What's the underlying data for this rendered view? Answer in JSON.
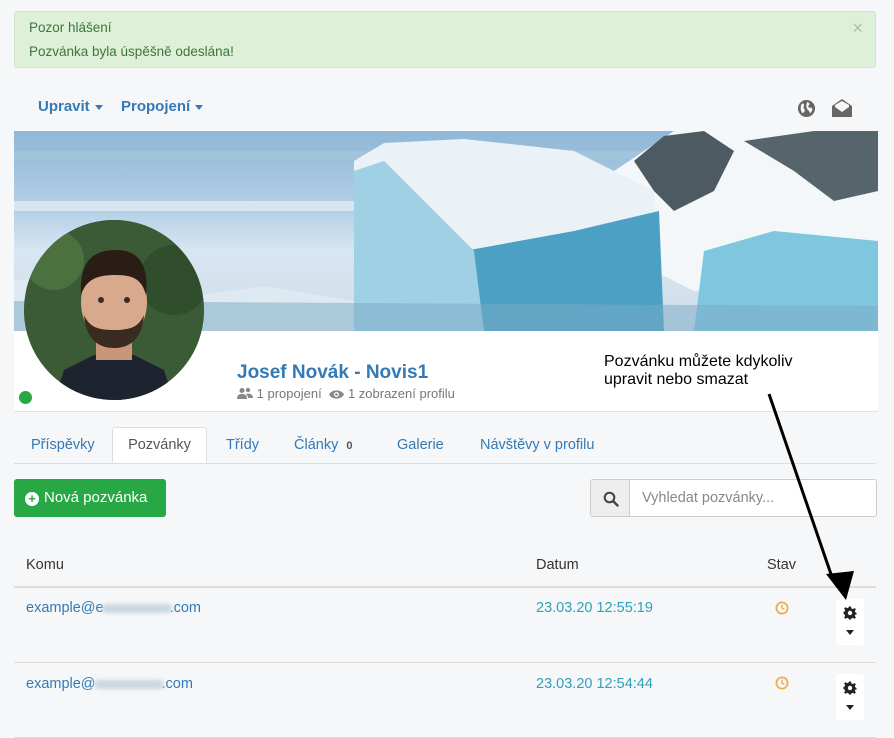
{
  "alert": {
    "title": "Pozor hlášení",
    "message": "Pozvánka byla úspěšně odeslána!",
    "close_label": "×"
  },
  "nav": {
    "items": [
      {
        "label": "Upravit"
      },
      {
        "label": "Propojení"
      }
    ],
    "icons": [
      "globe-icon",
      "envelope-open-icon"
    ]
  },
  "profile": {
    "name": "Josef Novák - Novis1",
    "connections": "1 propojení",
    "views": "1 zobrazení profilu",
    "status_color": "#28a745"
  },
  "annotation": {
    "line1": "Pozvánku můžete kdykoliv",
    "line2": "upravit nebo smazat"
  },
  "tabs": [
    {
      "label": "Příspěvky"
    },
    {
      "label": "Pozvánky",
      "active": true
    },
    {
      "label": "Třídy"
    },
    {
      "label": "Články",
      "badge": "0"
    },
    {
      "label": "Galerie"
    },
    {
      "label": "Návštěvy v profilu"
    }
  ],
  "toolbar": {
    "new_button": "Nová pozvánka",
    "search_placeholder": "Vyhledat pozvánky..."
  },
  "table": {
    "headers": {
      "to": "Komu",
      "date": "Datum",
      "status": "Stav"
    },
    "rows": [
      {
        "email_start": "example@e",
        "email_end": ".com",
        "date": "23.03.20 12:55:19",
        "status_icon": "clock-icon"
      },
      {
        "email_start": "example@",
        "email_end": ".com",
        "date": "23.03.20 12:54:44",
        "status_icon": "clock-icon"
      }
    ]
  },
  "colors": {
    "link": "#337ab7",
    "success": "#28a745",
    "alert_bg": "#dff0d8",
    "pending": "#f0ad4e"
  }
}
